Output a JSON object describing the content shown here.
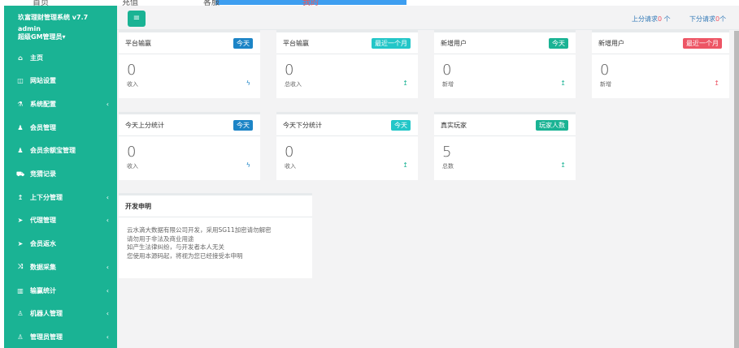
{
  "top_nav": [
    "首页",
    "充值",
    "客服",
    "我的"
  ],
  "sidebar": {
    "brand": "玖富理财管理系统 v7.7",
    "username": "admin",
    "role": "超级GM管理员",
    "items": [
      {
        "label": "主页",
        "icon": "home-icon",
        "glyph": "⌂",
        "arrow": false
      },
      {
        "label": "网站设置",
        "icon": "columns-icon",
        "glyph": "◫",
        "arrow": false
      },
      {
        "label": "系统配置",
        "icon": "flask-icon",
        "glyph": "⚗",
        "arrow": true
      },
      {
        "label": "会员管理",
        "icon": "user-icon",
        "glyph": "♟",
        "arrow": false
      },
      {
        "label": "会员余额宝管理",
        "icon": "user-icon",
        "glyph": "♟",
        "arrow": false
      },
      {
        "label": "竞猜记录",
        "icon": "car-icon",
        "glyph": "⛟",
        "arrow": false
      },
      {
        "label": "上下分管理",
        "icon": "level-up-icon",
        "glyph": "↥",
        "arrow": true
      },
      {
        "label": "代理管理",
        "icon": "paper-plane-icon",
        "glyph": "➤",
        "arrow": true
      },
      {
        "label": "会员返水",
        "icon": "paper-plane-icon",
        "glyph": "➤",
        "arrow": false
      },
      {
        "label": "数据采集",
        "icon": "random-icon",
        "glyph": "⤨",
        "arrow": true
      },
      {
        "label": "输赢统计",
        "icon": "bar-chart-icon",
        "glyph": "▥",
        "arrow": true
      },
      {
        "label": "机器人管理",
        "icon": "male-icon",
        "glyph": "♙",
        "arrow": true
      },
      {
        "label": "管理员管理",
        "icon": "male-icon",
        "glyph": "♙",
        "arrow": true
      }
    ],
    "arrow": "‹",
    "caret": "▾"
  },
  "header": {
    "menu_glyph": "≡",
    "up_label": "上分请求",
    "up_count": "0",
    "up_unit": " 个",
    "down_label": "下分请求",
    "down_count": "0",
    "down_unit": "个"
  },
  "cards": [
    {
      "title": "平台输赢",
      "badge": "今天",
      "badge_color": "#1c84c6",
      "value": "0",
      "sub": "收入",
      "icon": "ϟ",
      "icon_color": "#1c84c6"
    },
    {
      "title": "平台输赢",
      "badge": "最近一个月",
      "badge_color": "#23c6c8",
      "value": "0",
      "sub": "总收入",
      "icon": "↥",
      "icon_color": "#1ab394"
    },
    {
      "title": "新增用户",
      "badge": "今天",
      "badge_color": "#1ab394",
      "value": "0",
      "sub": "新增",
      "icon": "↥",
      "icon_color": "#1ab394"
    },
    {
      "title": "新增用户",
      "badge": "最近一个月",
      "badge_color": "#ed5565",
      "value": "0",
      "sub": "新增",
      "icon": "↥",
      "icon_color": "#ed5565"
    },
    {
      "title": "今天上分统计",
      "badge": "今天",
      "badge_color": "#1c84c6",
      "value": "0",
      "sub": "收入",
      "icon": "ϟ",
      "icon_color": "#1c84c6"
    },
    {
      "title": "今天下分统计",
      "badge": "今天",
      "badge_color": "#23c6c8",
      "value": "0",
      "sub": "收入",
      "icon": "↥",
      "icon_color": "#1ab394"
    },
    {
      "title": "真实玩家",
      "badge": "玩家人数",
      "badge_color": "#1ab394",
      "value": "5",
      "sub": "总数",
      "icon": "↥",
      "icon_color": "#1ab394"
    }
  ],
  "notice": {
    "title": "开发申明",
    "lines": [
      "云水滴大数据有限公司开发，采用SG11加密请勿解密",
      "请勿用于非法及商业用途",
      "如产生法律纠纷，与开发者本人无关",
      "您使用本源码起，将视为您已经接受本申明"
    ]
  }
}
